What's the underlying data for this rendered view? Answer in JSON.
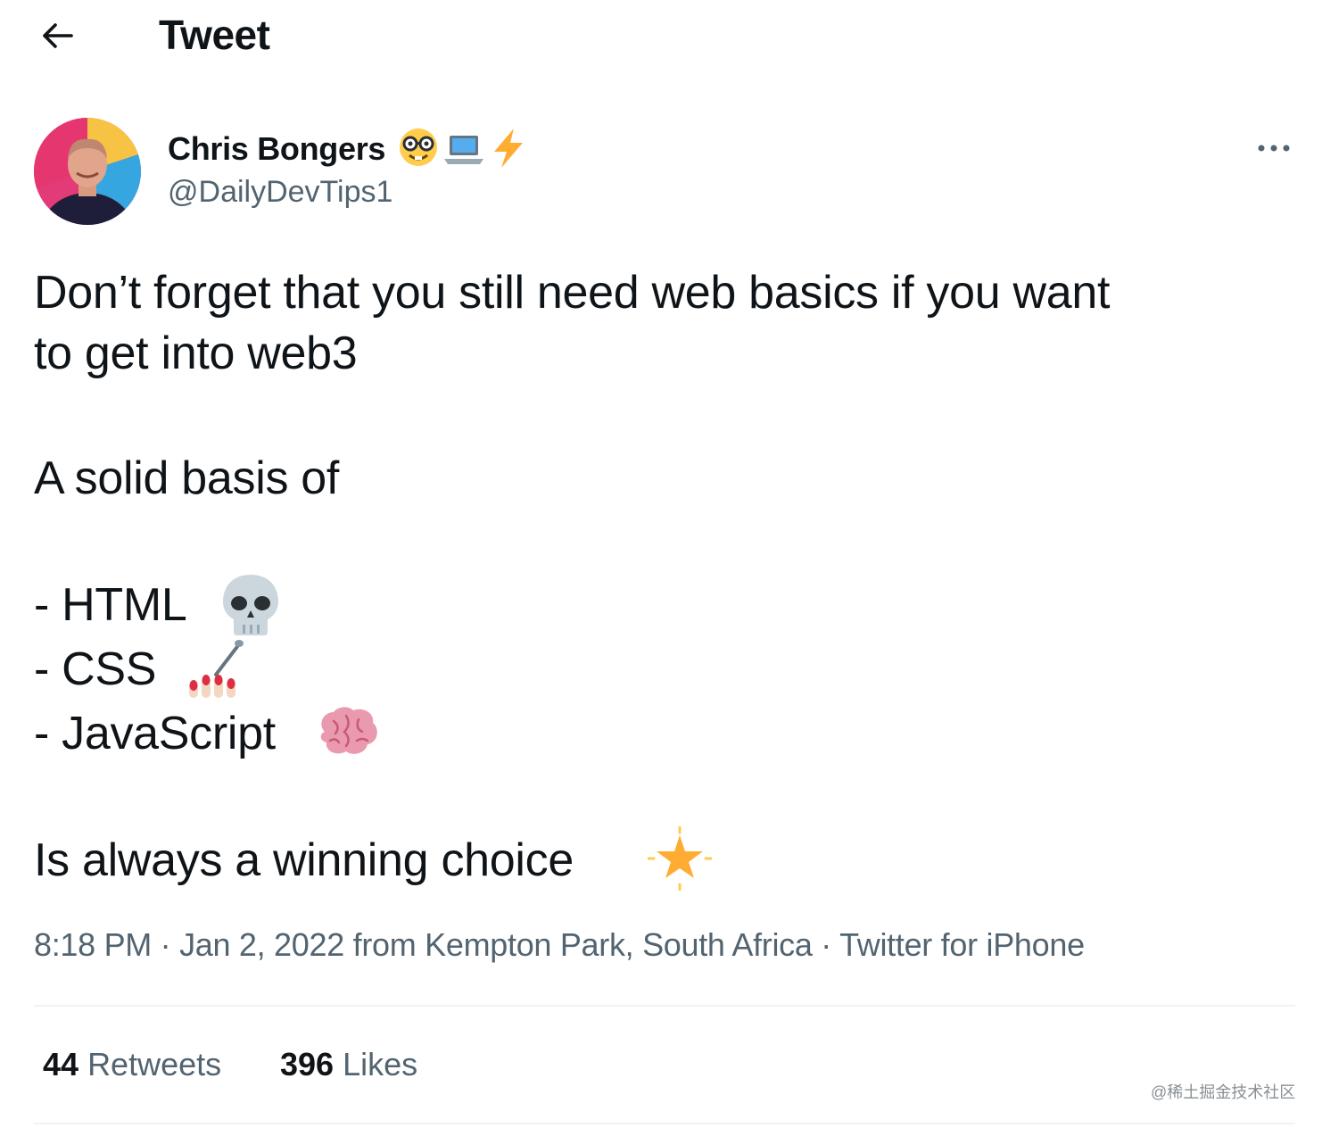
{
  "header": {
    "back_icon": "arrow-left-icon",
    "title": "Tweet"
  },
  "author": {
    "name": "Chris Bongers",
    "name_emojis": [
      "nerd-face-icon",
      "laptop-icon",
      "lightning-bolt-icon"
    ],
    "handle": "@DailyDevTips1"
  },
  "more_icon": "more-horizontal-icon",
  "tweet": {
    "line1": "Don’t forget that you still need web basics if you want",
    "line2": "to get into web3",
    "line3": "A solid basis of",
    "html_item": "- HTML",
    "css_item": "- CSS",
    "js_item": "- JavaScript",
    "closing": "Is always a winning choice",
    "emojis": {
      "html": "skull-icon",
      "css": "nail-polish-icon",
      "js": "brain-icon",
      "closing": "glowing-star-icon"
    }
  },
  "meta": {
    "time": "8:18 PM",
    "separator": "·",
    "date": "Jan 2, 2022",
    "from": "from",
    "location": "Kempton Park, South Africa",
    "source": "Twitter for iPhone"
  },
  "stats": {
    "retweets_count": "44",
    "retweets_label": "Retweets",
    "likes_count": "396",
    "likes_label": "Likes"
  },
  "watermark": "@稀土掘金技术社区",
  "colors": {
    "text": "#0f1419",
    "secondary": "#536471",
    "divider": "#eff3f4"
  }
}
